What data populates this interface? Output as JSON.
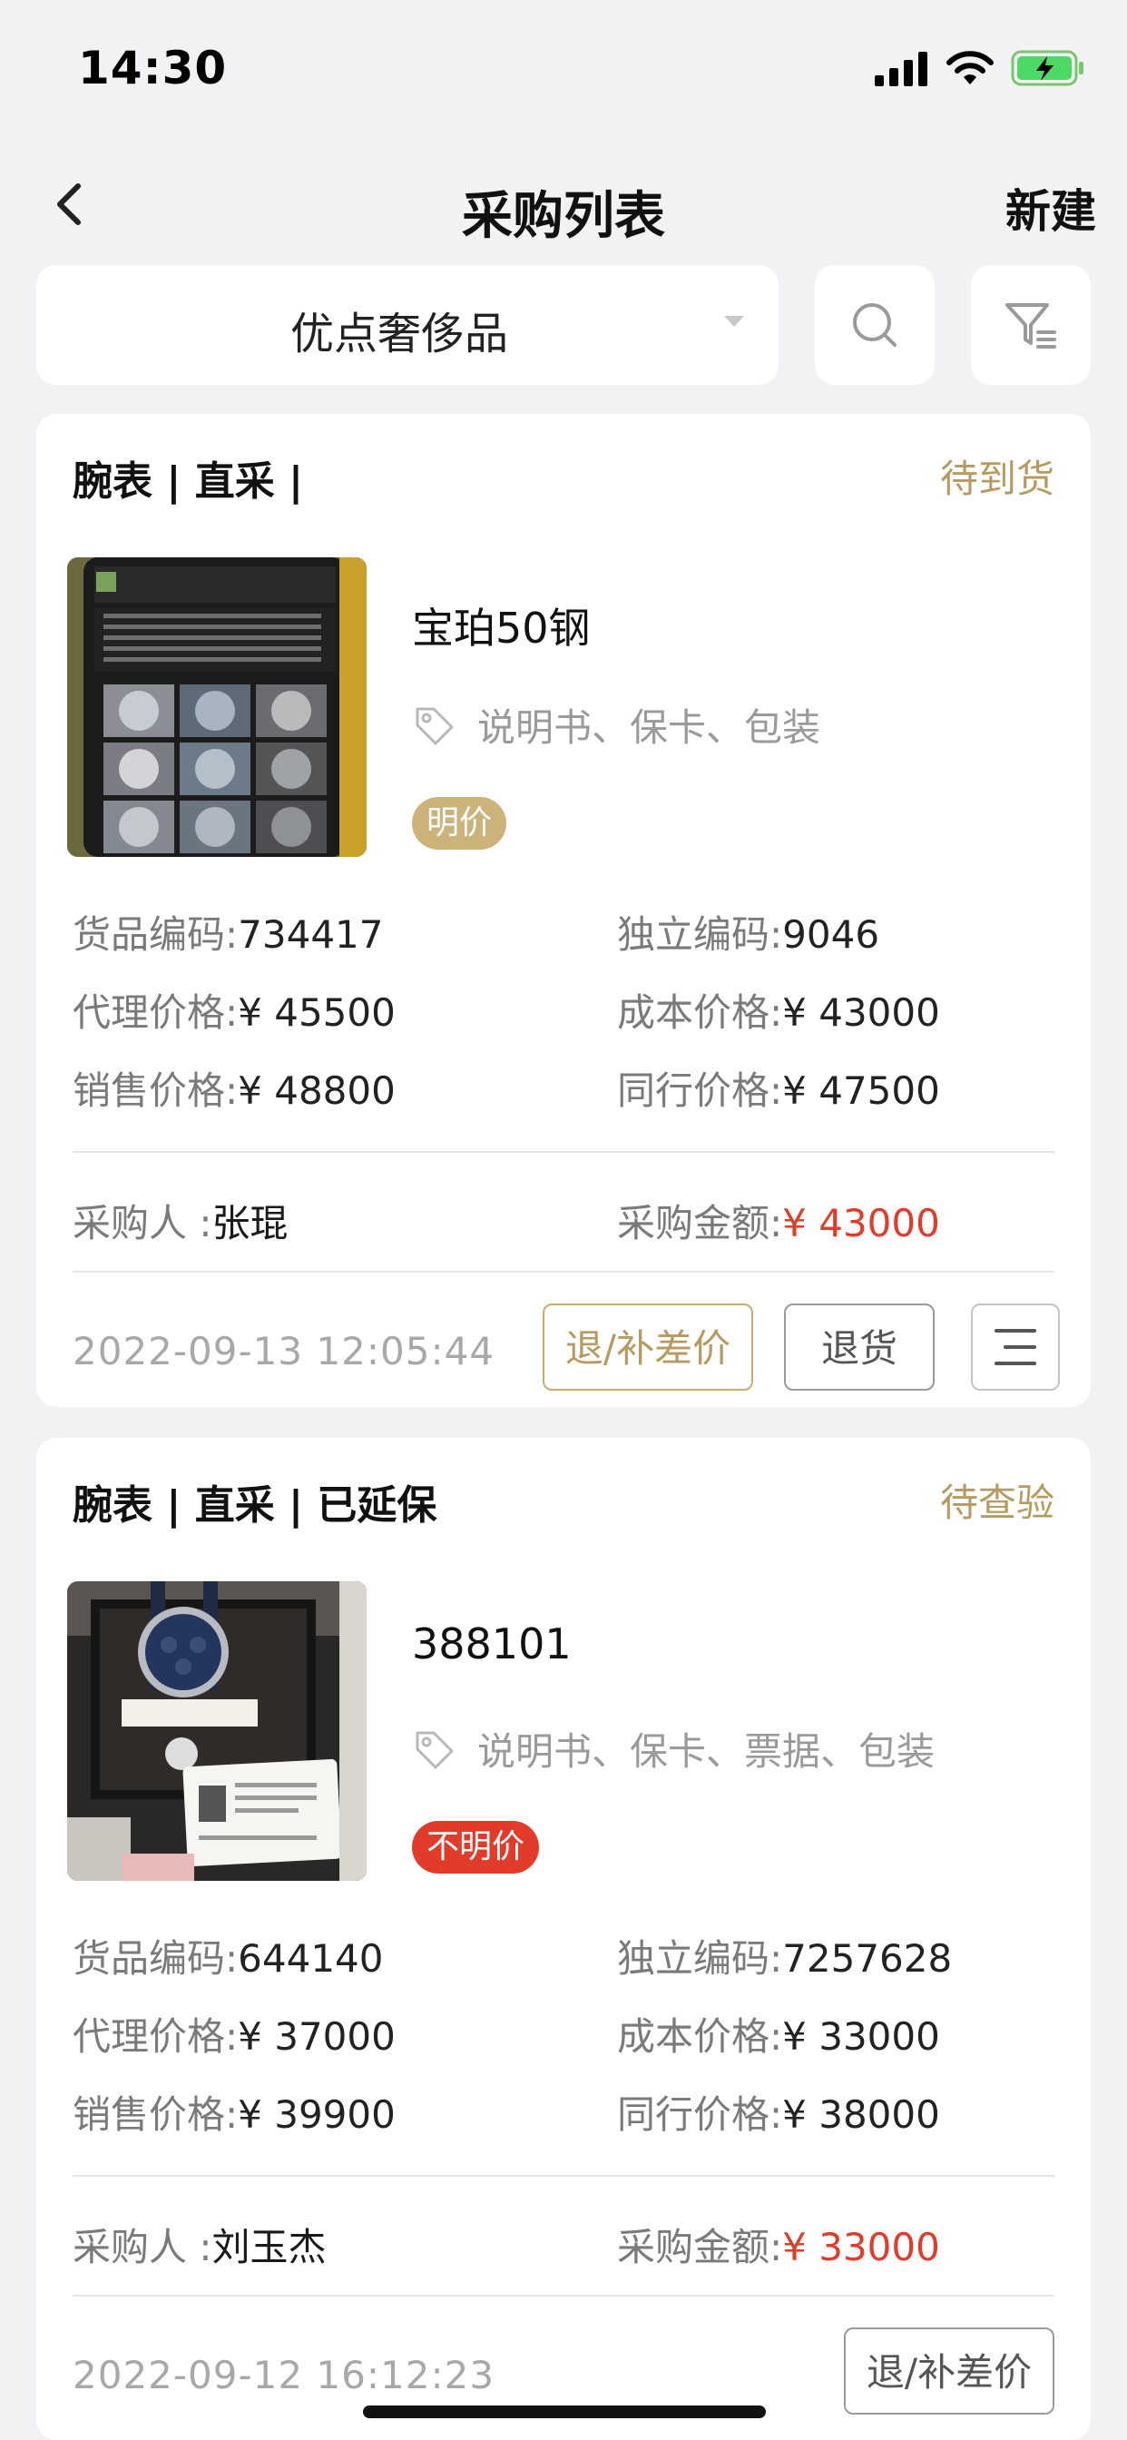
{
  "status_bar": {
    "time": "14:30"
  },
  "nav": {
    "title": "采购列表",
    "new_label": "新建"
  },
  "filter": {
    "store_name": "优点奢侈品"
  },
  "cards": [
    {
      "category": "腕表 | 直采 |",
      "status": "待到货",
      "product_name": "宝珀50钢",
      "accessories": "说明书、保卡、包装",
      "price_badge": "明价",
      "goods_code_label": "货品编码:",
      "goods_code": "734417",
      "unique_code_label": "独立编码:",
      "unique_code": "9046",
      "agent_price_label": "代理价格:",
      "agent_price": "¥ 45500",
      "cost_price_label": "成本价格:",
      "cost_price": "¥ 43000",
      "sale_price_label": "销售价格:",
      "sale_price": "¥ 48800",
      "peer_price_label": "同行价格:",
      "peer_price": "¥ 47500",
      "buyer_label": "采购人 :",
      "buyer": "张琨",
      "amount_label": "采购金额:",
      "amount": "¥ 43000",
      "date": "2022-09-13 12:05:44",
      "btn_diff": "退/补差价",
      "btn_return": "退货"
    },
    {
      "category": "腕表 | 直采 | 已延保",
      "status": "待查验",
      "product_name": "388101",
      "accessories": "说明书、保卡、票据、包装",
      "price_badge": "不明价",
      "goods_code_label": "货品编码:",
      "goods_code": "644140",
      "unique_code_label": "独立编码:",
      "unique_code": "7257628",
      "agent_price_label": "代理价格:",
      "agent_price": "¥ 37000",
      "cost_price_label": "成本价格:",
      "cost_price": "¥ 33000",
      "sale_price_label": "销售价格:",
      "sale_price": "¥ 39900",
      "peer_price_label": "同行价格:",
      "peer_price": "¥ 38000",
      "buyer_label": "采购人 :",
      "buyer": "刘玉杰",
      "amount_label": "采购金额:",
      "amount": "¥ 33000",
      "date": "2022-09-12 16:12:23",
      "btn_diff": "退/补差价"
    }
  ],
  "colors": {
    "gold": "#b59b60",
    "red": "#e23b2a",
    "badge_gold": "#cbb37a"
  }
}
